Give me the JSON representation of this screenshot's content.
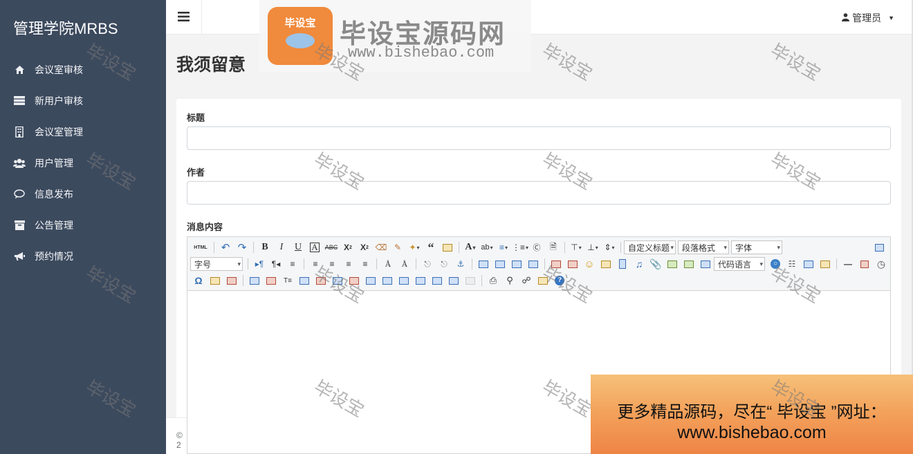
{
  "app": {
    "brand": "管理学院MRBS"
  },
  "sidebar": {
    "items": [
      {
        "label": "会议室审核",
        "icon": "home-icon"
      },
      {
        "label": "新用户审核",
        "icon": "server-icon"
      },
      {
        "label": "会议室管理",
        "icon": "building-icon"
      },
      {
        "label": "用户管理",
        "icon": "users-icon"
      },
      {
        "label": "信息发布",
        "icon": "comment-icon"
      },
      {
        "label": "公告管理",
        "icon": "archive-icon"
      },
      {
        "label": "预约情况",
        "icon": "bullhorn-icon"
      }
    ]
  },
  "topbar": {
    "user_label": "管理员"
  },
  "page": {
    "title": "我须留意"
  },
  "form": {
    "title_label": "标题",
    "title_value": "",
    "author_label": "作者",
    "author_value": "",
    "content_label": "消息内容"
  },
  "editor": {
    "custom_title_select": "自定义标题",
    "paragraph_select": "段落格式",
    "font_family_select": "字体",
    "font_size_select": "字号",
    "code_lang_select": "代码语言",
    "html_button": "HTML"
  },
  "footer": {
    "text": "© 2"
  },
  "watermark": {
    "logo_badge": "毕设宝",
    "logo_name": "毕设宝源码网",
    "logo_url": "www.bishebao.com",
    "tile_text": "毕设宝"
  },
  "promo": {
    "line1": "更多精品源码，尽在“ 毕设宝 ”网址：",
    "line2": "www.bishebao.com"
  }
}
